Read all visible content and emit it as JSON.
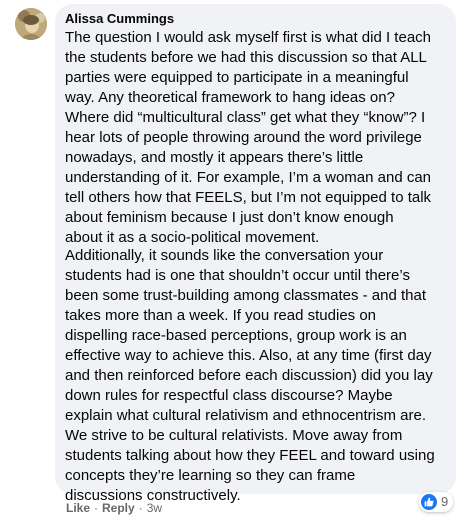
{
  "comment": {
    "author": "Alissa Cummings",
    "paragraphs": [
      [
        "The question I would ask myself first is what did I teach",
        "the students before we had this discussion so that ALL",
        "parties were equipped to participate in a meaningful",
        "way. Any theoretical framework to hang ideas on?",
        "Where did “multicultural class” get what they “know”? I",
        "hear lots of people throwing around the word privilege",
        "nowadays, and mostly it appears there’s little",
        "understanding of it. For example, I’m a woman and can",
        "tell others how that FEELS, but I’m not equipped to talk",
        "about feminism because I just don’t know enough",
        "about it as a socio-political movement."
      ],
      [
        "Additionally, it sounds like the conversation your",
        "students had is one that shouldn’t occur until there’s",
        "been some trust-building among classmates - and that",
        "takes more than a week. If you read studies on",
        "dispelling race-based perceptions, group work is an",
        "effective way to achieve this. Also, at any time (first day",
        "and then reinforced before each discussion) did you lay",
        "down rules for respectful class discourse? Maybe",
        "explain what cultural relativism and ethnocentrism are.",
        "We strive to be cultural relativists. Move away from",
        "students talking about how they FEEL and toward using",
        "concepts they’re learning so they can frame",
        "discussions constructively."
      ]
    ],
    "actions": {
      "like": "Like",
      "reply": "Reply",
      "separator": "·",
      "time": "3w"
    },
    "reactions": {
      "icon": "thumbs-up-icon",
      "count": "9"
    }
  },
  "colors": {
    "bubble": "#f0f2f5",
    "text": "#050505",
    "secondary_text": "#65676b",
    "like_blue": "#1877f2"
  }
}
